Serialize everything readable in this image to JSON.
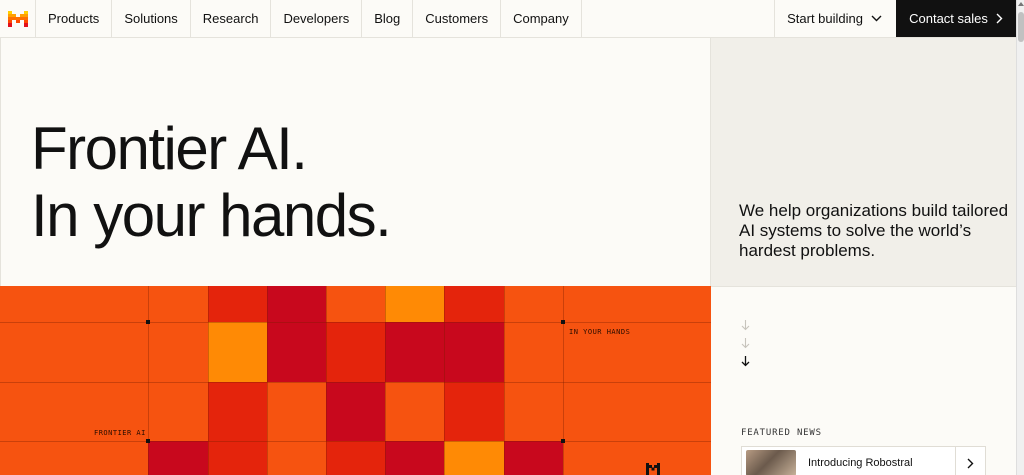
{
  "nav": {
    "items": [
      "Products",
      "Solutions",
      "Research",
      "Developers",
      "Blog",
      "Customers",
      "Company"
    ],
    "start_building": "Start building",
    "contact_sales": "Contact sales"
  },
  "hero": {
    "title_line1": "Frontier AI.",
    "title_line2": "In your hands.",
    "subtitle": "We help organizations build tailored AI systems to solve the world’s hardest problems."
  },
  "pixel_art": {
    "label_left": "FRONTIER AI",
    "label_right": "IN YOUR HANDS"
  },
  "featured": {
    "label": "FEATURED NEWS",
    "news_title": "Introducing Robostral"
  },
  "colors": {
    "accent_orange": "#f65310",
    "deep_red": "#c8081d",
    "red": "#e4240c",
    "amber": "#ff8a05",
    "brand_dark": "#111111"
  },
  "icons": {
    "logo": "mistral-logo-icon",
    "start_dropdown": "chevron-down-icon",
    "contact_arrow": "chevron-right-icon",
    "scroll_arrows": "arrow-down-icon",
    "news_arrow": "chevron-right-icon"
  }
}
